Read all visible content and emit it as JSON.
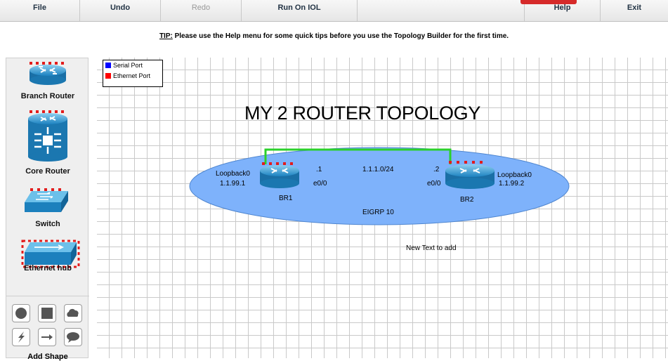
{
  "menu": {
    "file": "File",
    "undo": "Undo",
    "redo": "Redo",
    "run": "Run On IOL",
    "help": "Help",
    "exit": "Exit"
  },
  "tip": {
    "prefix": "TIP:",
    "text": " Please use the Help menu for some quick tips before you use the Topology Builder for the first time."
  },
  "sidebar": {
    "devices": [
      {
        "label": "Branch Router",
        "icon": "router-icon"
      },
      {
        "label": "Core Router",
        "icon": "core-router-icon"
      },
      {
        "label": "Switch",
        "icon": "switch-icon"
      },
      {
        "label": "Ethernet hub",
        "icon": "hub-icon"
      }
    ],
    "shapes_label": "Add Shape",
    "shapes": [
      "circle-icon",
      "square-icon",
      "cloud-icon",
      "lightning-icon",
      "arrow-icon",
      "speech-bubble-icon"
    ]
  },
  "legend": {
    "serial": "Serial Port",
    "ethernet": "Ethernet Port",
    "serial_color": "#0000ff",
    "ethernet_color": "#ff0000"
  },
  "canvas": {
    "title": "MY 2 ROUTER TOPOLOGY",
    "area_label": "EIGRP 10",
    "network": "1.1.1.0/24",
    "new_text": "New Text to add",
    "routers": [
      {
        "name": "BR1",
        "loopback": "Loopback0",
        "loopback_ip": "1.1.99.1",
        "interface": "e0/0",
        "host": ".1"
      },
      {
        "name": "BR2",
        "loopback": "Loopback0",
        "loopback_ip": "1.1.99.2",
        "interface": "e0/0",
        "host": ".2"
      }
    ],
    "link_color": "#2bd02b",
    "ellipse_color": "#7eb2fb"
  }
}
